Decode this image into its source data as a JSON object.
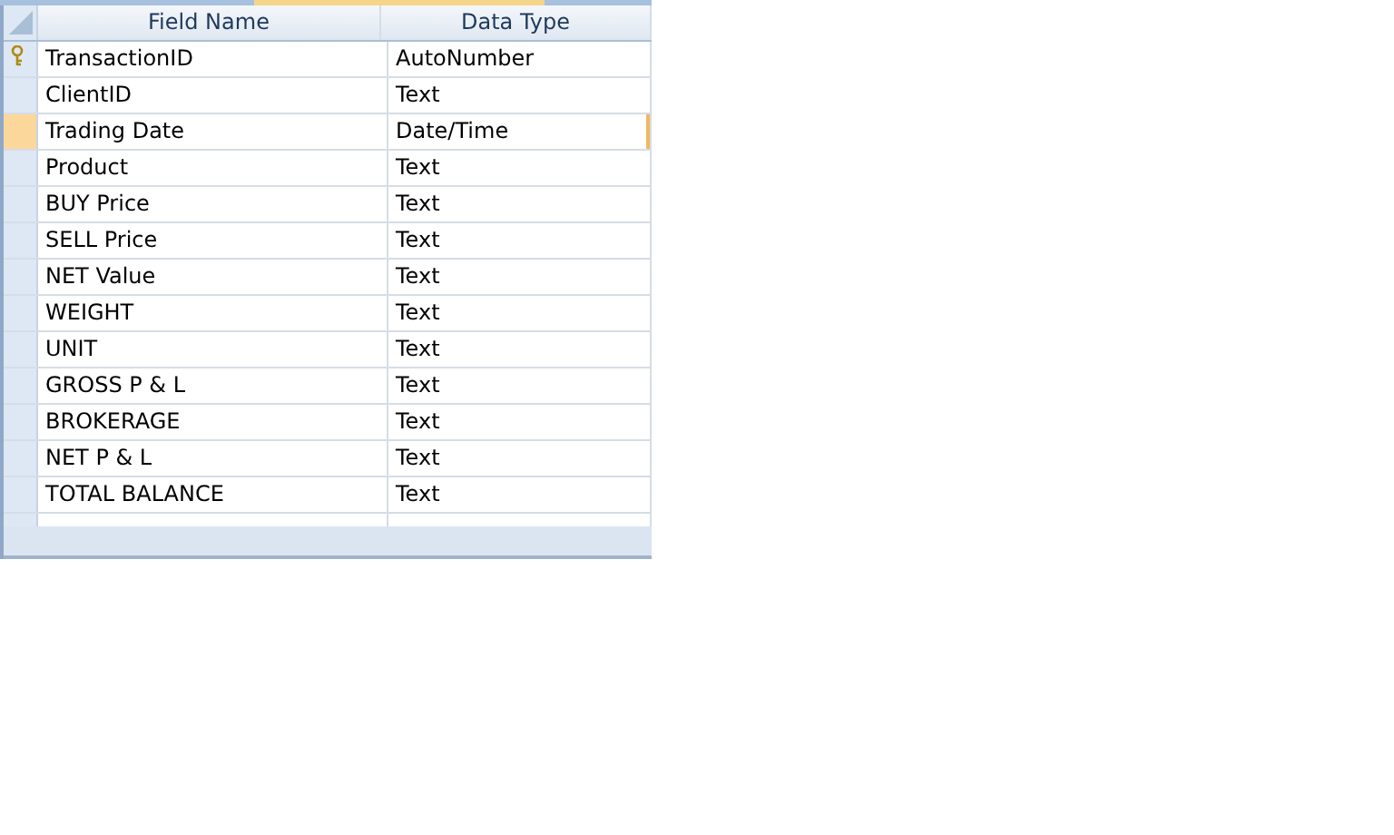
{
  "table": {
    "columns": [
      "Field Name",
      "Data Type"
    ],
    "rows": [
      {
        "field": "TransactionID",
        "type": "AutoNumber",
        "primary_key": true,
        "selected": false
      },
      {
        "field": "ClientID",
        "type": "Text",
        "primary_key": false,
        "selected": false
      },
      {
        "field": "Trading Date",
        "type": "Date/Time",
        "primary_key": false,
        "selected": true
      },
      {
        "field": "Product",
        "type": "Text",
        "primary_key": false,
        "selected": false
      },
      {
        "field": "BUY Price",
        "type": "Text",
        "primary_key": false,
        "selected": false
      },
      {
        "field": "SELL Price",
        "type": "Text",
        "primary_key": false,
        "selected": false
      },
      {
        "field": "NET Value",
        "type": "Text",
        "primary_key": false,
        "selected": false
      },
      {
        "field": "WEIGHT",
        "type": "Text",
        "primary_key": false,
        "selected": false
      },
      {
        "field": "UNIT",
        "type": "Text",
        "primary_key": false,
        "selected": false
      },
      {
        "field": "GROSS P & L",
        "type": "Text",
        "primary_key": false,
        "selected": false
      },
      {
        "field": "BROKERAGE",
        "type": "Text",
        "primary_key": false,
        "selected": false
      },
      {
        "field": "NET P & L",
        "type": "Text",
        "primary_key": false,
        "selected": false
      },
      {
        "field": "TOTAL BALANCE",
        "type": "Text",
        "primary_key": false,
        "selected": false
      }
    ]
  }
}
